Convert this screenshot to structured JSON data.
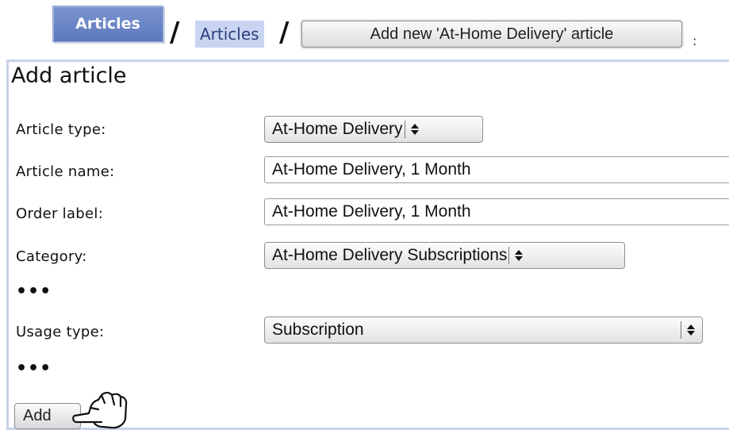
{
  "breadcrumb": {
    "root_button": "Articles",
    "link": "Articles",
    "action_button": "Add new 'At-Home Delivery' article",
    "separator": "/",
    "trail": ":"
  },
  "form": {
    "title": "Add article",
    "fields": {
      "article_type": {
        "label": "Article type:",
        "value": "At-Home Delivery"
      },
      "article_name": {
        "label": "Article name:",
        "value": "At-Home Delivery, 1 Month"
      },
      "order_label": {
        "label": "Order label:",
        "value": "At-Home Delivery, 1 Month"
      },
      "category": {
        "label": "Category:",
        "value": "At-Home Delivery Subscriptions"
      },
      "usage_type": {
        "label": "Usage type:",
        "value": "Subscription"
      }
    },
    "ellipsis": "•••",
    "submit_label": "Add"
  },
  "icons": {
    "select_arrows": "updown-arrows-icon",
    "pointer": "pointing-hand-icon"
  },
  "colors": {
    "accent": "#6a84c5",
    "link_bg": "#c9d5f0",
    "panel_border": "#c8d3ea"
  }
}
